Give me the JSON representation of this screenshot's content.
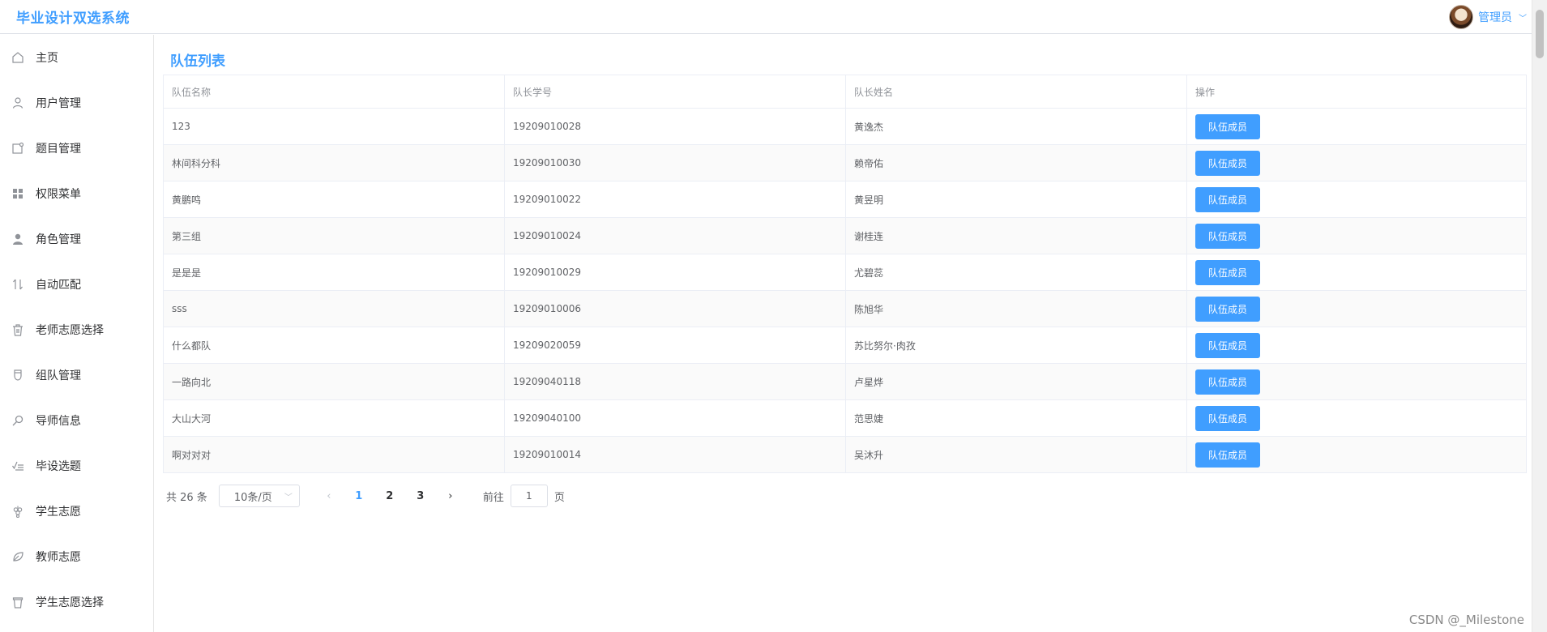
{
  "header": {
    "brand": "毕业设计双选系统",
    "user_name": "管理员",
    "user_caret": "﹀"
  },
  "sidebar": {
    "items": [
      {
        "label": "主页",
        "icon": "home-icon"
      },
      {
        "label": "用户管理",
        "icon": "user-icon"
      },
      {
        "label": "题目管理",
        "icon": "topic-icon"
      },
      {
        "label": "权限菜单",
        "icon": "grid-icon"
      },
      {
        "label": "角色管理",
        "icon": "role-icon"
      },
      {
        "label": "自动匹配",
        "icon": "sort-icon"
      },
      {
        "label": "老师志愿选择",
        "icon": "trash-icon"
      },
      {
        "label": "组队管理",
        "icon": "cup-icon"
      },
      {
        "label": "导师信息",
        "icon": "search-icon"
      },
      {
        "label": "毕设选题",
        "icon": "check-list-icon"
      },
      {
        "label": "学生志愿",
        "icon": "grape-icon"
      },
      {
        "label": "教师志愿",
        "icon": "leaf-icon"
      },
      {
        "label": "学生志愿选择",
        "icon": "bin-icon"
      }
    ]
  },
  "main": {
    "title": "队伍列表",
    "columns": [
      "队伍名称",
      "队长学号",
      "队长姓名",
      "操作"
    ],
    "rows": [
      {
        "team": "123",
        "leader_id": "19209010028",
        "leader_name": "黄逸杰"
      },
      {
        "team": "林间科分科",
        "leader_id": "19209010030",
        "leader_name": "赖帝佑"
      },
      {
        "team": "黄鹏鸣",
        "leader_id": "19209010022",
        "leader_name": "黄昱明"
      },
      {
        "team": "第三组",
        "leader_id": "19209010024",
        "leader_name": "谢桂连"
      },
      {
        "team": "是是是",
        "leader_id": "19209010029",
        "leader_name": "尤碧蕊"
      },
      {
        "team": "sss",
        "leader_id": "19209010006",
        "leader_name": "陈旭华"
      },
      {
        "team": "什么都队",
        "leader_id": "19209020059",
        "leader_name": "苏比努尔·肉孜"
      },
      {
        "team": "一路向北",
        "leader_id": "19209040118",
        "leader_name": "卢星烨"
      },
      {
        "team": "大山大河",
        "leader_id": "19209040100",
        "leader_name": "范思婕"
      },
      {
        "team": "啊对对对",
        "leader_id": "19209010014",
        "leader_name": "吴沐升"
      }
    ],
    "action_label": "队伍成员"
  },
  "pagination": {
    "total": "共 26 条",
    "page_size": "10条/页",
    "page_size_caret": "﹀",
    "prev": "‹",
    "next": "›",
    "pages": [
      "1",
      "2",
      "3"
    ],
    "current": "1",
    "goto_label": "前往",
    "goto_value": "1",
    "page_unit": "页"
  },
  "watermark": "CSDN @_Milestone",
  "colors": {
    "accent": "#409eff",
    "stripe": "#fafafa",
    "border": "#ebeef5"
  }
}
